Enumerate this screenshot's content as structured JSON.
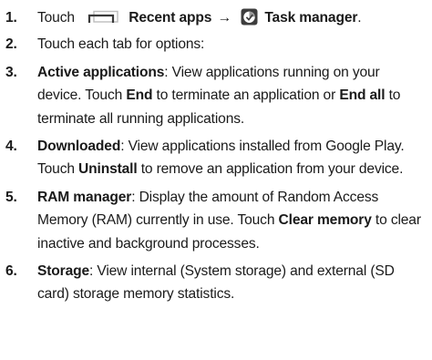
{
  "steps": [
    {
      "num": "1.",
      "touch": "Touch",
      "recent_label": "Recent apps",
      "arrow": "→",
      "task_label": "Task manager",
      "end": ".",
      "icons": [
        "recent-apps-icon",
        "task-manager-icon"
      ]
    },
    {
      "num": "2.",
      "text": "Touch each tab for options:"
    },
    {
      "num": "3.",
      "title": "Active applications",
      "t1": ": View applications running on your device. Touch ",
      "b1": "End",
      "t2": " to terminate an application or ",
      "b2": "End all",
      "t3": " to terminate all running applications."
    },
    {
      "num": "4.",
      "title": "Downloaded",
      "t1": ": View applications installed from Google Play. Touch ",
      "b1": "Uninstall",
      "t2": " to remove an application from your device."
    },
    {
      "num": "5.",
      "title": "RAM manager",
      "t1": ": Display the amount of Random Access Memory (RAM) currently in use. Touch ",
      "b1": "Clear memory",
      "t2": " to clear inactive and background processes."
    },
    {
      "num": "6.",
      "title": "Storage",
      "t1": ": View internal (System storage) and external (SD card) storage memory statistics."
    }
  ],
  "colors": {
    "text": "#1a1a1a",
    "icon_dark": "#3a3a3a",
    "icon_light": "#bdbdbd"
  }
}
